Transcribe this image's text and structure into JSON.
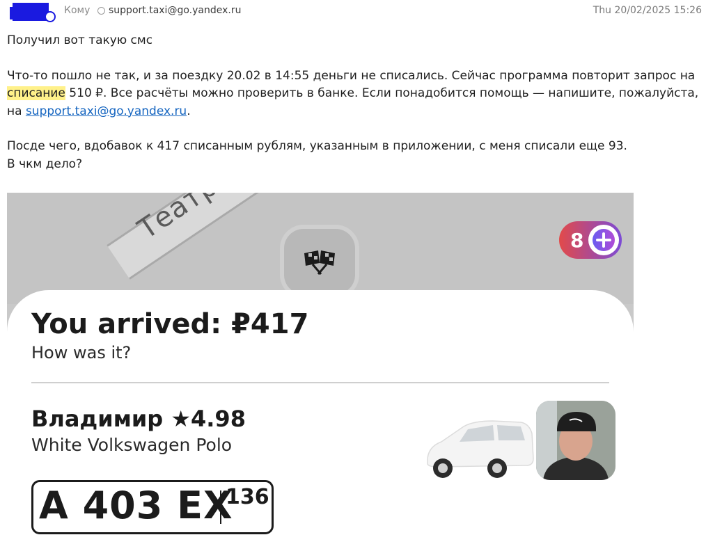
{
  "header": {
    "to_label": "Кому",
    "recipient": "support.taxi@go.yandex.ru",
    "datetime": "Thu 20/02/2025 15:26"
  },
  "message": {
    "line1": "Получил вот такую смс",
    "sms_part1": "Что-то пошло не так, и за поездку 20.02 в 14:55 деньги не списались. Сейчас программа повторит запрос на ",
    "sms_highlight": "списание",
    "sms_part2": " 510 ₽. Все расчёты можно проверить в банке. Если понадобится помощь — напишите, пожалуйста, на ",
    "sms_link": "support.taxi@go.yandex.ru",
    "sms_end": ".",
    "line3": "Посде чего, вдобавок к 417 списанным рублям, указанным в приложении, с меня списали еще 93.",
    "line4": "В чкм дело?"
  },
  "screenshot": {
    "street_name": "Театральн",
    "plus_badge_number": "8",
    "title": "You arrived: ₽417",
    "subtitle": "How was it?",
    "driver": "Владимир ★4.98",
    "car": "White Volkswagen Polo",
    "plate_number": "A 403 EX",
    "plate_region": "136",
    "colors": {
      "badge_start": "#e24a4a",
      "badge_end": "#7c4bd6",
      "highlight": "#fff18a",
      "link": "#1565c0"
    }
  }
}
